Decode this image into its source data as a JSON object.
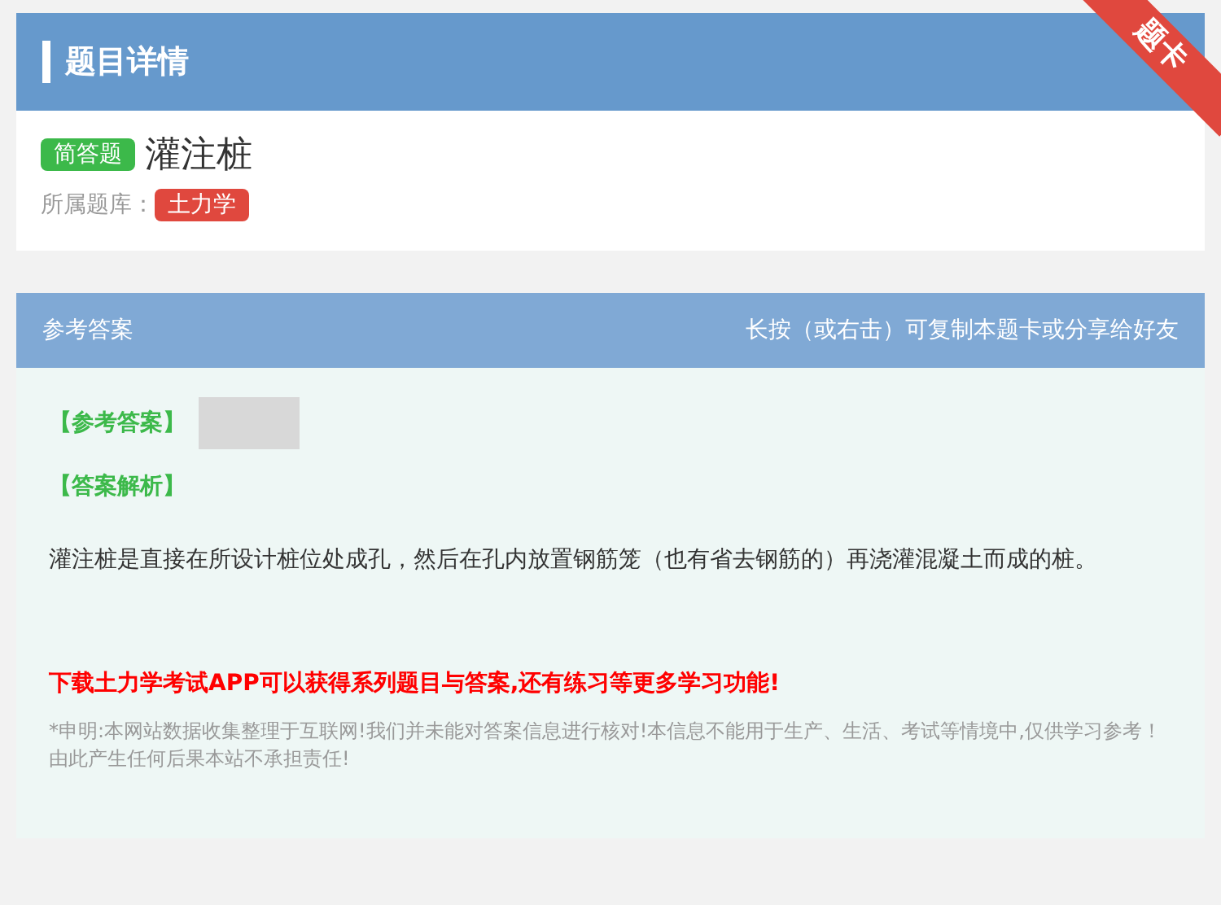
{
  "header": {
    "title": "题目详情",
    "ribbon": "题卡"
  },
  "question": {
    "type_tag": "简答题",
    "title": "灌注桩",
    "bank_label": "所属题库：",
    "bank_tag": "土力学"
  },
  "answer_header": {
    "title": "参考答案",
    "hint": "长按（或右击）可复制本题卡或分享给好友"
  },
  "answer": {
    "answer_label": "【参考答案】",
    "analysis_label": "【答案解析】",
    "analysis_text": "灌注桩是直接在所设计桩位处成孔，然后在孔内放置钢筋笼（也有省去钢筋的）再浇灌混凝土而成的桩。",
    "promo": "下载土力学考试APP可以获得系列题目与答案,还有练习等更多学习功能!",
    "disclaimer": "*申明:本网站数据收集整理于互联网!我们并未能对答案信息进行核对!本信息不能用于生产、生活、考试等情境中,仅供学习参考！由此产生任何后果本站不承担责任!"
  }
}
